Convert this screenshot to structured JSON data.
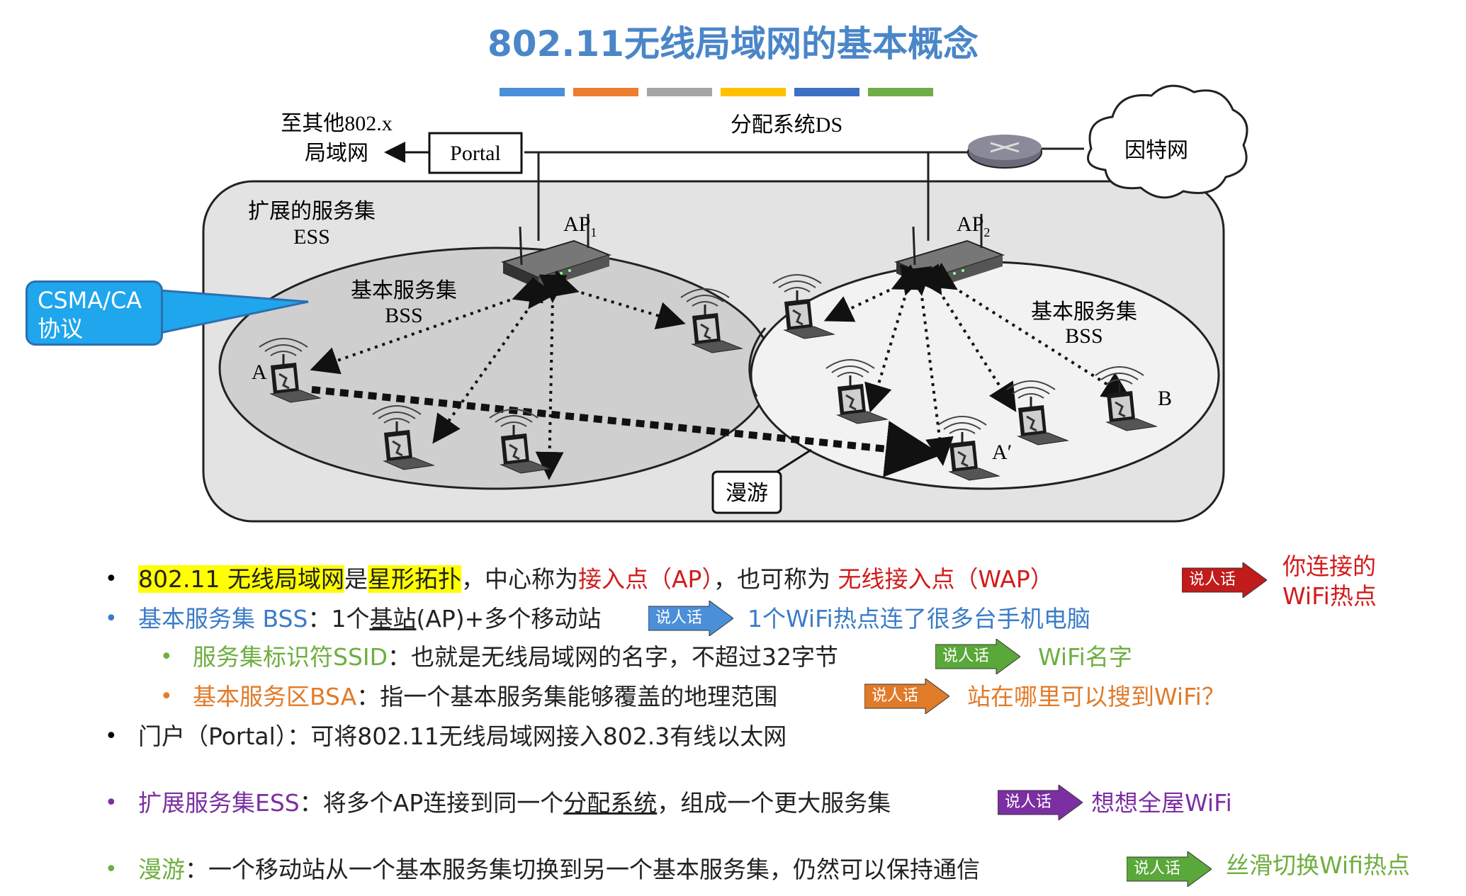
{
  "title": "802.11无线局域网的基本概念",
  "color_bar": [
    "#4a90d9",
    "#ed7d31",
    "#a5a5a5",
    "#ffc000",
    "#3d6fc4",
    "#70ad47"
  ],
  "diagram": {
    "other_lan_line1": "至其他802.x",
    "other_lan_line2": "局域网",
    "portal": "Portal",
    "ds": "分配系统DS",
    "internet": "因特网",
    "ess_line1": "扩展的服务集",
    "ess_line2": "ESS",
    "ap1": "AP",
    "ap1_sub": "1",
    "ap2": "AP",
    "ap2_sub": "2",
    "bss1_line1": "基本服务集",
    "bss1_line2": "BSS",
    "bss2_line1": "基本服务集",
    "bss2_line2": "BSS",
    "station_a": "A",
    "station_a_prime": "A′",
    "station_b": "B",
    "roaming": "漫游"
  },
  "callout": {
    "line1": "CSMA/CA",
    "line2": "协议"
  },
  "tag_label": "说人话",
  "bullets": {
    "b1": {
      "t1": "802.11 无线局域网",
      "t2": "是",
      "t3": "星形拓扑",
      "t4": "，中心称为",
      "t5": "接入点（AP）",
      "t6": "，也可称为 ",
      "t7": "无线接入点（WAP）",
      "res_line1": "你连接的",
      "res_line2": "WiFi热点"
    },
    "b2": {
      "t1": "基本服务集 BSS",
      "t2": "：1个",
      "t3": "基站",
      "t4": "(AP)+多个移动站",
      "res": "1个WiFi热点连了很多台手机电脑"
    },
    "b3": {
      "t1": "服务集标识符SSID",
      "t2": "：也就是无线局域网的名字，不超过32字节",
      "res": "WiFi名字"
    },
    "b4": {
      "t1": "基本服务区BSA",
      "t2": "：指一个基本服务集能够覆盖的地理范围",
      "res": "站在哪里可以搜到WiFi？"
    },
    "b5": {
      "t1": "门户（Portal）：可将802.11无线局域网接入802.3有线以太网"
    },
    "b6": {
      "t1": "扩展服务集ESS",
      "t2": "：将多个AP连接到同一个",
      "t3": "分配系统",
      "t4": "，组成一个更大服务集",
      "res": "想想全屋WiFi"
    },
    "b7": {
      "t1": "漫游",
      "t2": "：一个移动站从一个基本服务集切换到另一个基本服务集，仍然可以保持通信",
      "res": "丝滑切换Wifi热点"
    }
  }
}
